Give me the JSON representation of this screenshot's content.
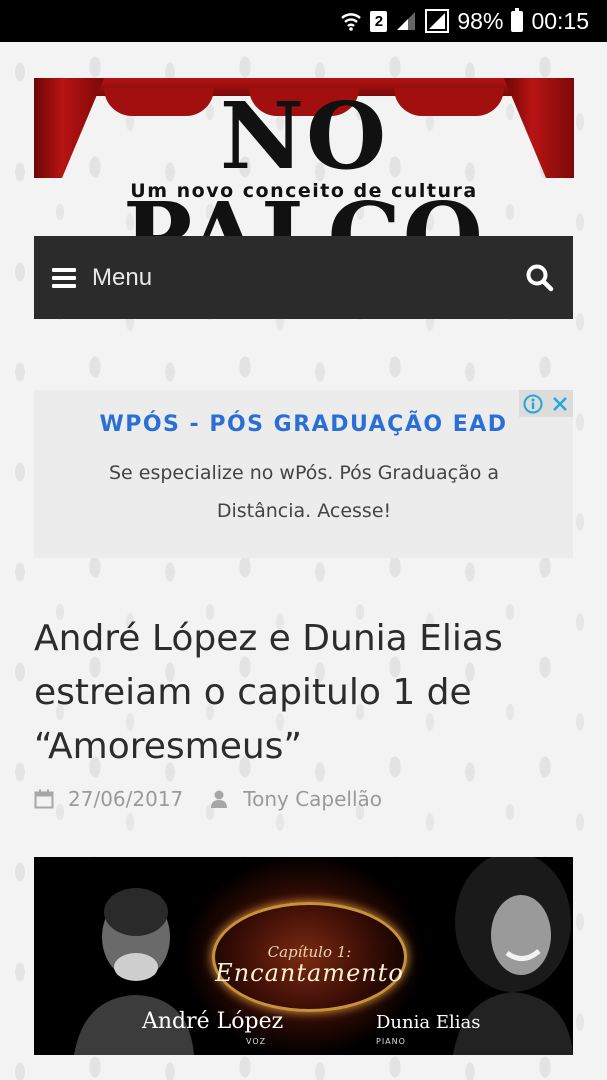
{
  "status_bar": {
    "sim_slot": "2",
    "battery": "98%",
    "time": "00:15"
  },
  "header": {
    "logo_title": "NO PALCO",
    "logo_subtitle": "Um novo conceito de cultura"
  },
  "nav": {
    "menu_label": "Menu"
  },
  "ad": {
    "title": "WPÓS - PÓS GRADUAÇÃO EAD",
    "body": "Se especialize no wPós. Pós Graduação a Distância. Acesse!",
    "accent_color": "#2a6fd6"
  },
  "post": {
    "title": "André López e Dunia Elias estreiam o capitulo 1 de “Amoresmeus”",
    "date": "27/06/2017",
    "author": "Tony Capellão"
  },
  "featured_image": {
    "chapter": "Capítulo 1:",
    "chapter_name": "Encantamento",
    "artist_left": "André López",
    "artist_left_role": "VOZ",
    "artist_right": "Dunia Elias",
    "artist_right_role": "PIANO"
  },
  "icons": [
    "wifi-icon",
    "sim-badge",
    "signal-icon",
    "battery-icon",
    "hamburger-icon",
    "search-icon",
    "adchoices-icon",
    "close-icon",
    "calendar-icon",
    "user-icon"
  ]
}
